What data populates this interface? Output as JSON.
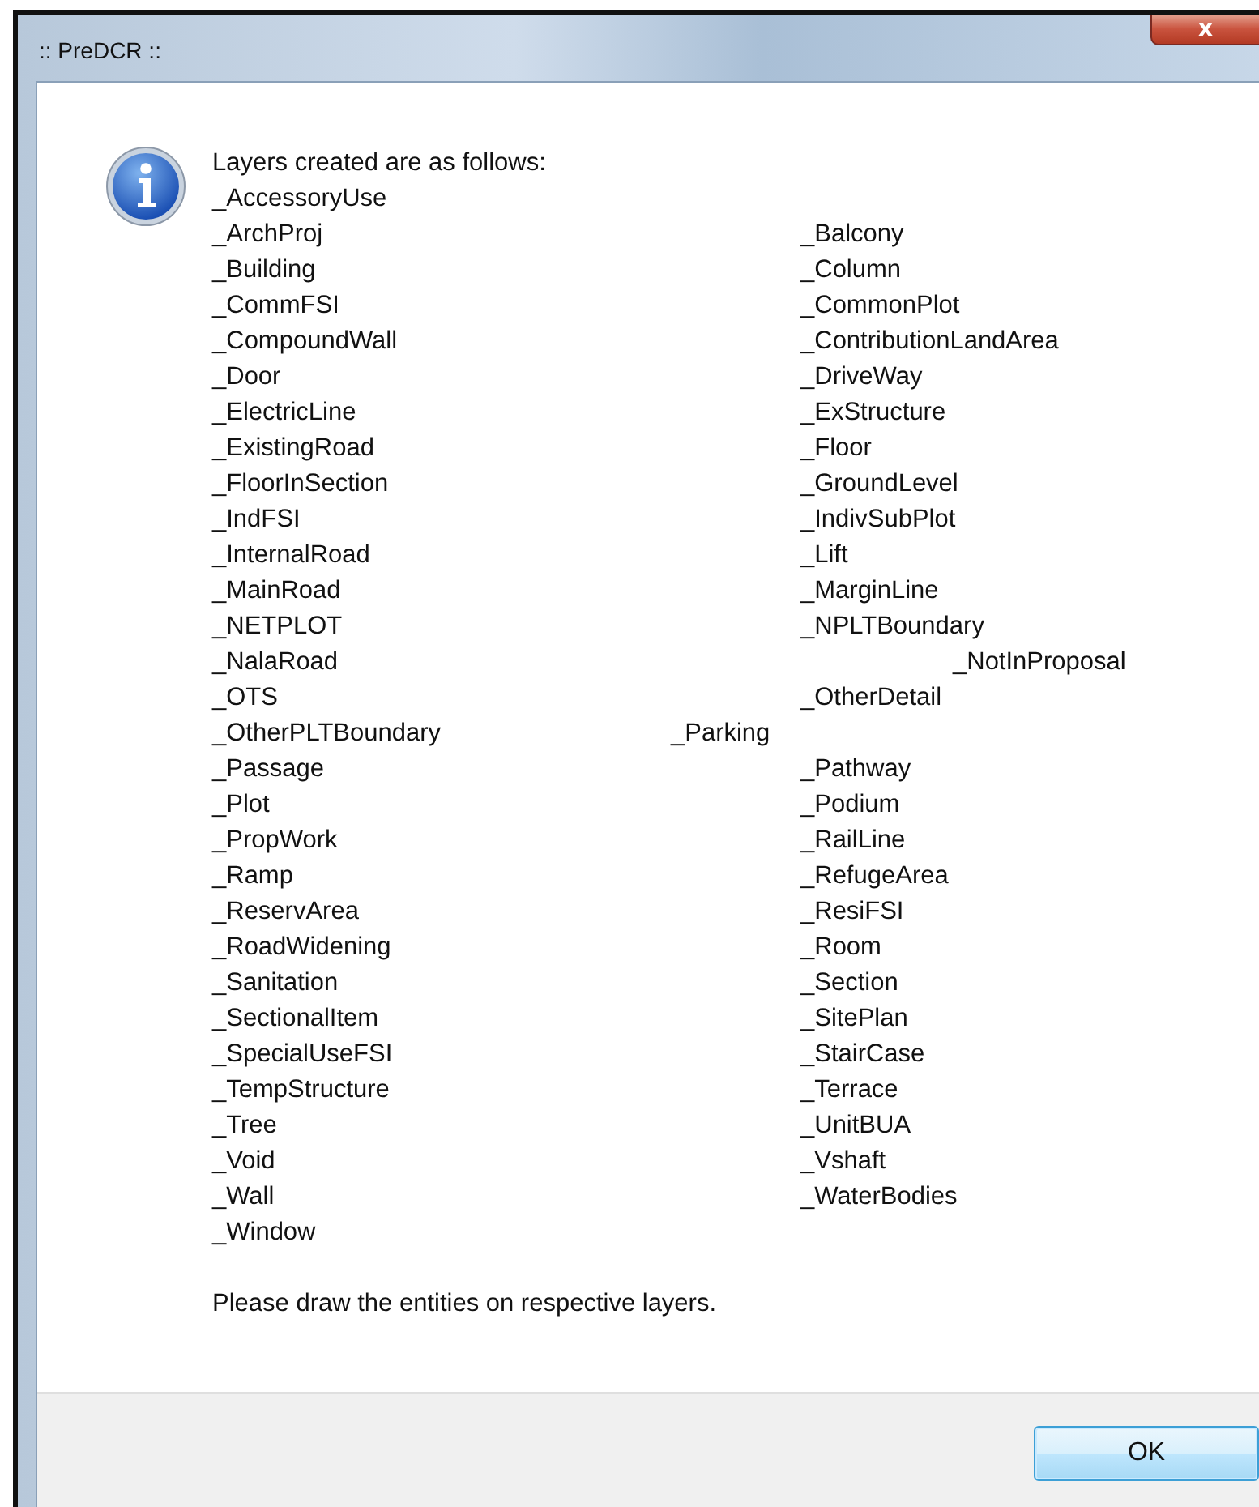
{
  "window": {
    "title": ":: PreDCR ::",
    "close_button": "x"
  },
  "message": {
    "heading": "Layers created are as follows:",
    "rows": [
      {
        "col_1": "_AccessoryUse"
      },
      {
        "col_1": "_ArchProj",
        "col_3": "_Balcony"
      },
      {
        "col_1": "_Building",
        "col_3": "_Column"
      },
      {
        "col_1": "_CommFSI",
        "col_3": "_CommonPlot"
      },
      {
        "col_1": "_CompoundWall",
        "col_3": "_ContributionLandArea"
      },
      {
        "col_1": "_Door",
        "col_3": "_DriveWay"
      },
      {
        "col_1": "_ElectricLine",
        "col_3": "_ExStructure"
      },
      {
        "col_1": "_ExistingRoad",
        "col_3": "_Floor"
      },
      {
        "col_1": "_FloorInSection",
        "col_3": "_GroundLevel"
      },
      {
        "col_1": "_IndFSI",
        "col_3": "_IndivSubPlot"
      },
      {
        "col_1": "_InternalRoad",
        "col_3": "_Lift"
      },
      {
        "col_1": "_MainRoad",
        "col_3": "_MarginLine"
      },
      {
        "col_1": "_NETPLOT",
        "col_3": "_NPLTBoundary"
      },
      {
        "col_1": "_NalaRoad",
        "col_4": "_NotInProposal"
      },
      {
        "col_1": "_OTS",
        "col_3": "_OtherDetail"
      },
      {
        "col_1": "_OtherPLTBoundary",
        "col_2": "_Parking"
      },
      {
        "col_1": "_Passage",
        "col_3": "_Pathway"
      },
      {
        "col_1": "_Plot",
        "col_3": "_Podium"
      },
      {
        "col_1": "_PropWork",
        "col_3": "_RailLine"
      },
      {
        "col_1": "_Ramp",
        "col_3": "_RefugeArea"
      },
      {
        "col_1": "_ReservArea",
        "col_3": "_ResiFSI"
      },
      {
        "col_1": "_RoadWidening",
        "col_3": "_Room"
      },
      {
        "col_1": "_Sanitation",
        "col_3": "_Section"
      },
      {
        "col_1": "_SectionalItem",
        "col_3": "_SitePlan"
      },
      {
        "col_1": "_SpecialUseFSI",
        "col_3": "_StairCase"
      },
      {
        "col_1": "_TempStructure",
        "col_3": "_Terrace"
      },
      {
        "col_1": "_Tree",
        "col_3": "_UnitBUA"
      },
      {
        "col_1": "_Void",
        "col_3": "_Vshaft"
      },
      {
        "col_1": "_Wall",
        "col_3": "_WaterBodies"
      },
      {
        "col_1": "_Window"
      }
    ],
    "footer": "Please draw the entities on respective layers."
  },
  "buttons": [
    "OK"
  ]
}
